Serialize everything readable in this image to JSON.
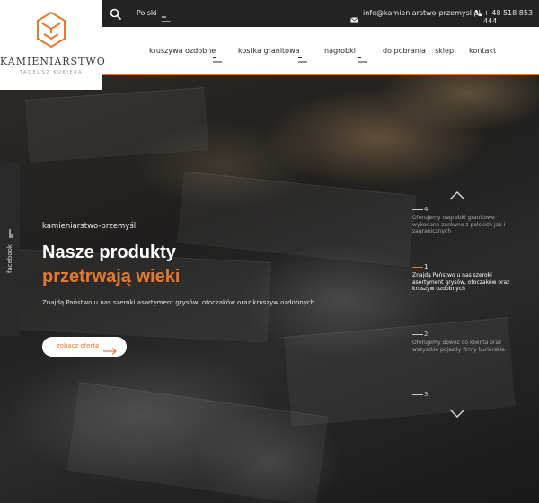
{
  "brand": {
    "name": "KAMIENIARSTWO",
    "subtitle": "TADEUSZ KUKIERA"
  },
  "topbar": {
    "language": "Polski",
    "email": "info@kamieniarstwo-przemysl.pl",
    "phone": "+ 48 518 853 444"
  },
  "nav": {
    "items": [
      {
        "label": "kruszywa ozdobne",
        "dropdown": true
      },
      {
        "label": "kostka granitowa",
        "dropdown": true
      },
      {
        "label": "nagrobki",
        "dropdown": true
      },
      {
        "label": "do pobrania",
        "dropdown": false
      },
      {
        "label": "sklep",
        "dropdown": false
      },
      {
        "label": "kontakt",
        "dropdown": false
      }
    ]
  },
  "social": {
    "facebook_label": "facebook"
  },
  "hero": {
    "eyebrow": "kamieniarstwo-przemyśl",
    "headline_line1": "Nasze produkty",
    "headline_line2": "przetrwają wieki",
    "description": "Znajdą Państwo u nas szeroki asortyment grysów, otoczaków oraz kruszyw ozdobnych",
    "cta_label": "zobacz ofertę"
  },
  "slides": [
    {
      "number": "4",
      "text": "Oferujemy nagrobki granitowe wykonane zarówno z polskich jak i zagranicznych",
      "active": false
    },
    {
      "number": "1",
      "text": "Znajdą Państwo u nas szeroki asortyment grysów, otoczaków oraz kruszyw ozdobnych",
      "active": true
    },
    {
      "number": "2",
      "text": "Oferujemy dowóz do klienta oraz wszystkie pojazdy firmy kurierskie",
      "active": false
    },
    {
      "number": "3",
      "text": "",
      "active": false
    }
  ],
  "colors": {
    "accent": "#e37a34",
    "topbar": "#232323",
    "navbar": "#ffffff"
  },
  "icons": [
    "search-icon",
    "menu-lines-icon",
    "mail-icon",
    "phone-icon",
    "logo-cube-icon",
    "arrow-right-icon",
    "chevron-up-icon",
    "chevron-down-icon"
  ]
}
